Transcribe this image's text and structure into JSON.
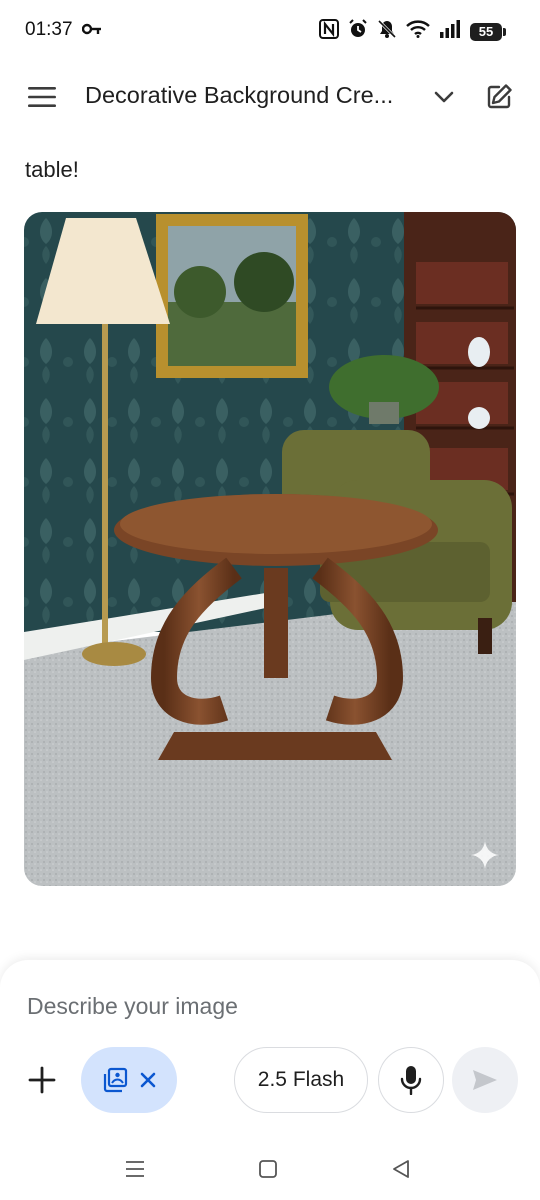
{
  "status_bar": {
    "time": "01:37",
    "battery_level": "55",
    "icons": [
      "key-icon",
      "nfc-icon",
      "alarm-icon",
      "bell-off-icon",
      "wifi-icon",
      "signal-icon",
      "battery-icon"
    ]
  },
  "header": {
    "title": "Decorative Background Cre...",
    "icons": [
      "menu-icon",
      "chevron-down-icon",
      "edit-icon"
    ]
  },
  "message": {
    "text": "table!"
  },
  "generated_image": {
    "subject": "round wooden pedestal table in a room with a floor lamp, framed landscape painting, green armchair and bookshelf",
    "badge_icon": "sparkle-icon"
  },
  "composer": {
    "placeholder": "Describe your image",
    "model_label": "2.5 Flash",
    "icons": [
      "plus-icon",
      "image-gallery-icon",
      "close-icon",
      "microphone-icon",
      "send-icon"
    ]
  },
  "nav_bar": {
    "icons": [
      "recents-icon",
      "home-icon",
      "back-icon"
    ]
  },
  "colors": {
    "chip_background": "#d3e3fd",
    "accent_blue": "#0b57d0",
    "send_background": "#eef0f4",
    "text_primary": "#1f1f1f",
    "placeholder_gray": "#6b6f73"
  }
}
